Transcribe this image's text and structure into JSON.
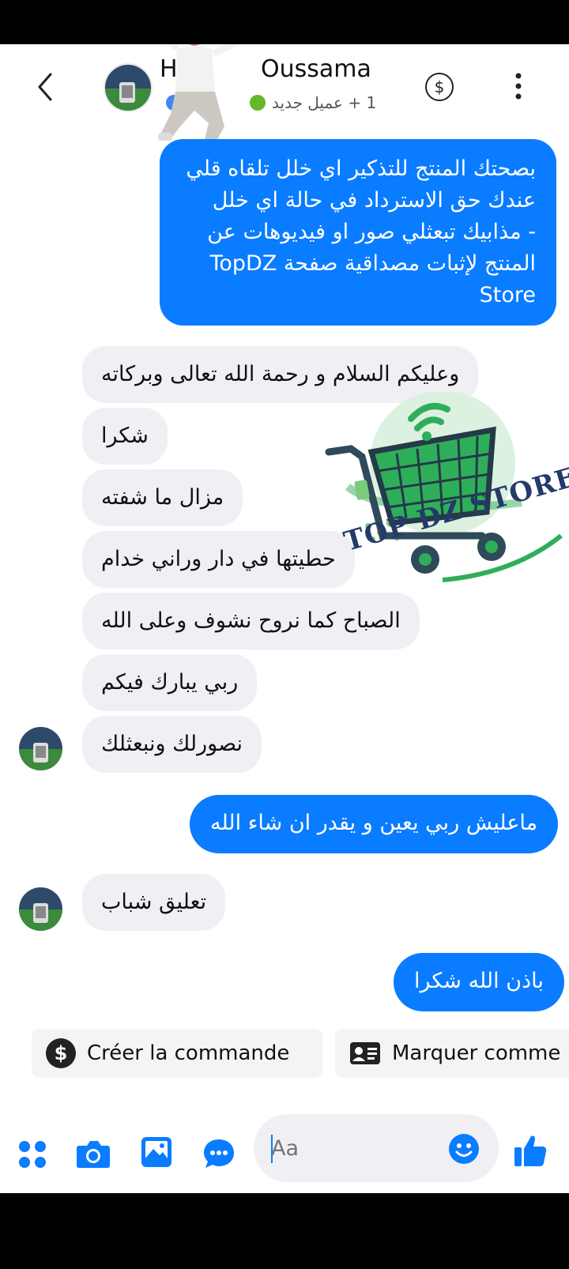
{
  "header": {
    "name_prefix": "H",
    "contact_name": "Oussama",
    "subtitle": "1 + عميل جديد"
  },
  "messages": [
    {
      "side": "out",
      "lines": [
        "بصحتك المنتج للتذكير اي خلل تلقاه قلي",
        "عندك حق الاسترداد في حالة اي خلل",
        "- مذابيك تبعثلي صور او فيديوهات عن",
        "المنتج لإثبات مصداقية صفحة TopDZ",
        "Store"
      ]
    },
    {
      "side": "in",
      "text": "وعليكم السلام و رحمة الله تعالى وبركاته"
    },
    {
      "side": "in",
      "text": "شكرا"
    },
    {
      "side": "in",
      "text": "مزال ما شفته"
    },
    {
      "side": "in",
      "text": "حطيتها في دار وراني خدام"
    },
    {
      "side": "in",
      "text": "الصباح كما نروح نشوف وعلى الله"
    },
    {
      "side": "in",
      "text": "ربي يبارك فيكم"
    },
    {
      "side": "in",
      "text": "نصورلك ونبعثلك"
    },
    {
      "side": "out",
      "text": "ماعليش ربي يعين و يقدر ان شاء الله"
    },
    {
      "side": "in",
      "text": "تعليق شباب"
    },
    {
      "side": "out",
      "text": "باذن الله شكرا"
    }
  ],
  "watermark": {
    "text": "TOP DZ STORE"
  },
  "actions": {
    "create_order": "Créer la commande",
    "mark_as": "Marquer comme"
  },
  "composer": {
    "placeholder": "Aa"
  },
  "colors": {
    "accent": "#0a7cff",
    "incoming_bubble": "#f0f0f4",
    "logo_green": "#2fae5a"
  }
}
